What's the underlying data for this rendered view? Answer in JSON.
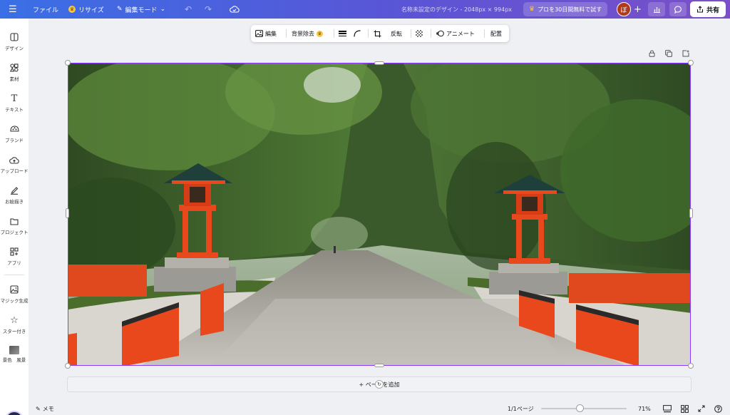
{
  "topbar": {
    "menu_icon": "☰",
    "file_label": "ファイル",
    "resize_label": "リサイズ",
    "mode_label": "編集モード",
    "doc_title": "名称未設定のデザイン - 2048px × 994px",
    "pro_label": "プロを30日間無料で試す",
    "avatar_initial": "ぼ",
    "share_label": "共有"
  },
  "sidebar": {
    "items": [
      {
        "label": "デザイン",
        "icon": "design-icon"
      },
      {
        "label": "素材",
        "icon": "elements-icon"
      },
      {
        "label": "テキスト",
        "icon": "text-icon"
      },
      {
        "label": "ブランド",
        "icon": "brand-icon"
      },
      {
        "label": "アップロード",
        "icon": "upload-icon"
      },
      {
        "label": "お絵描き",
        "icon": "draw-icon"
      },
      {
        "label": "プロジェクト",
        "icon": "folder-icon"
      },
      {
        "label": "アプリ",
        "icon": "apps-icon"
      },
      {
        "label": "マジック生成",
        "icon": "magic-media-icon"
      },
      {
        "label": "スター付き",
        "icon": "star-icon"
      },
      {
        "label": "景色　風景",
        "icon": "landscape-thumbnail"
      }
    ]
  },
  "context_toolbar": {
    "edit_label": "編集",
    "bg_remove_label": "背景除去",
    "flip_label": "反転",
    "animate_label": "アニメート",
    "position_label": "配置"
  },
  "canvas": {
    "add_page_label": "+ ページを追加"
  },
  "bottombar": {
    "notes_label": "メモ",
    "page_indicator": "1/1ページ",
    "zoom_value": "71%",
    "zoom_fraction": 0.45
  },
  "colors": {
    "accent": "#8b3dff",
    "topbar_start": "#3a6fe6",
    "topbar_end": "#7b4fc8",
    "lantern_orange": "#e8481c"
  }
}
